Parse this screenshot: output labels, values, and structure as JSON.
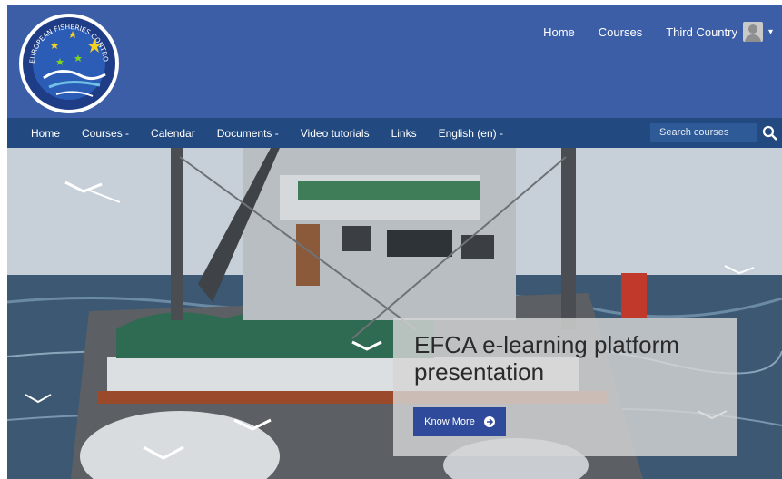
{
  "header": {
    "logo_text": "EUROPEAN FISHERIES CONTROL AGENCY",
    "top_links": [
      "Home",
      "Courses"
    ],
    "user_name": "Third Country"
  },
  "navbar": {
    "items": [
      "Home",
      "Courses -",
      "Calendar",
      "Documents -",
      "Video tutorials",
      "Links",
      "English (en) -"
    ],
    "search_placeholder": "Search courses"
  },
  "hero": {
    "title": "EFCA e-learning platform presentation",
    "button_label": "Know More"
  },
  "colors": {
    "header": "#3b5ea7",
    "navbar": "#234a80",
    "button": "#2f4a9a"
  }
}
